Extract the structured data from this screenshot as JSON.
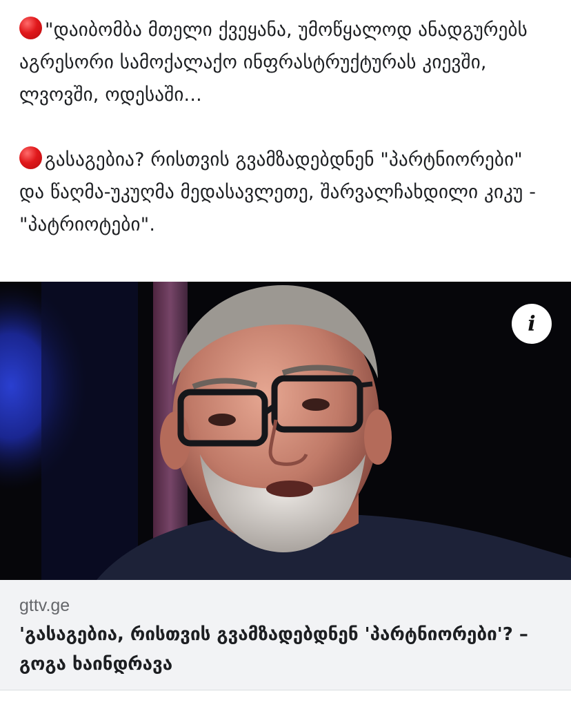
{
  "post": {
    "paragraph1": "\"დაიბომბა მთელი ქვეყანა, უმოწყალოდ ანადგურებს აგრესორი სამოქალაქო ინფრასტრუქტურას კიევში, ლვოვში, ოდესაში...",
    "paragraph2": "გასაგებია? რისთვის გვამზადებდნენ \"პარტნიორები\" და წაღმა-უკუღმა მედასავლეთე, შარვალჩახდილი კიკუ - \"პატრიოტები\".",
    "bullet_icon": "red-circle-emoji",
    "bullet_color": "#e0181b"
  },
  "link_preview": {
    "info_icon": "info-icon",
    "info_label": "i",
    "domain": "gttv.ge",
    "headline": "'გასაგებია, რისთვის გვამზადებდნენ 'პარტნიორები'? – გოგა ხაინდრავა"
  },
  "colors": {
    "card_footer_bg": "#f2f3f5",
    "domain_text": "#65676b",
    "headline_text": "#1c1e21"
  }
}
